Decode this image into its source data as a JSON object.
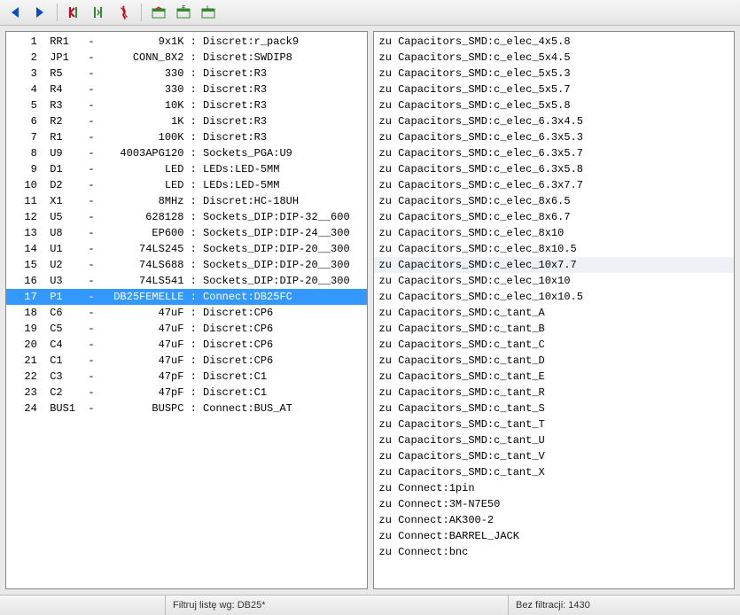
{
  "toolbar": {
    "buttons": [
      {
        "name": "nav-back-icon",
        "title": "Back"
      },
      {
        "name": "nav-forward-icon",
        "title": "Forward"
      },
      {
        "sep": true
      },
      {
        "name": "tool-red-icon",
        "title": "Tool A"
      },
      {
        "name": "tool-green-icon",
        "title": "Tool B"
      },
      {
        "name": "pdf-icon",
        "title": "PDF"
      },
      {
        "sep": true
      },
      {
        "name": "table-a-icon",
        "title": "Table A"
      },
      {
        "name": "table-b-icon",
        "title": "Table B"
      },
      {
        "name": "table-c-icon",
        "title": "Table C"
      }
    ]
  },
  "left_pane": {
    "selected_index": 16,
    "rows": [
      {
        "n": 1,
        "ref": "RR1",
        "dash": "-",
        "val": "9x1K",
        "sepc": ":",
        "fp": "Discret:r_pack9"
      },
      {
        "n": 2,
        "ref": "JP1",
        "dash": "-",
        "val": "CONN_8X2",
        "sepc": ":",
        "fp": "Discret:SWDIP8"
      },
      {
        "n": 3,
        "ref": "R5",
        "dash": "-",
        "val": "330",
        "sepc": ":",
        "fp": "Discret:R3"
      },
      {
        "n": 4,
        "ref": "R4",
        "dash": "-",
        "val": "330",
        "sepc": ":",
        "fp": "Discret:R3"
      },
      {
        "n": 5,
        "ref": "R3",
        "dash": "-",
        "val": "10K",
        "sepc": ":",
        "fp": "Discret:R3"
      },
      {
        "n": 6,
        "ref": "R2",
        "dash": "-",
        "val": "1K",
        "sepc": ":",
        "fp": "Discret:R3"
      },
      {
        "n": 7,
        "ref": "R1",
        "dash": "-",
        "val": "100K",
        "sepc": ":",
        "fp": "Discret:R3"
      },
      {
        "n": 8,
        "ref": "U9",
        "dash": "-",
        "val": "4003APG120",
        "sepc": ":",
        "fp": "Sockets_PGA:U9"
      },
      {
        "n": 9,
        "ref": "D1",
        "dash": "-",
        "val": "LED",
        "sepc": ":",
        "fp": "LEDs:LED-5MM"
      },
      {
        "n": 10,
        "ref": "D2",
        "dash": "-",
        "val": "LED",
        "sepc": ":",
        "fp": "LEDs:LED-5MM"
      },
      {
        "n": 11,
        "ref": "X1",
        "dash": "-",
        "val": "8MHz",
        "sepc": ":",
        "fp": "Discret:HC-18UH"
      },
      {
        "n": 12,
        "ref": "U5",
        "dash": "-",
        "val": "628128",
        "sepc": ":",
        "fp": "Sockets_DIP:DIP-32__600"
      },
      {
        "n": 13,
        "ref": "U8",
        "dash": "-",
        "val": "EP600",
        "sepc": ":",
        "fp": "Sockets_DIP:DIP-24__300"
      },
      {
        "n": 14,
        "ref": "U1",
        "dash": "-",
        "val": "74LS245",
        "sepc": ":",
        "fp": "Sockets_DIP:DIP-20__300"
      },
      {
        "n": 15,
        "ref": "U2",
        "dash": "-",
        "val": "74LS688",
        "sepc": ":",
        "fp": "Sockets_DIP:DIP-20__300"
      },
      {
        "n": 16,
        "ref": "U3",
        "dash": "-",
        "val": "74LS541",
        "sepc": ":",
        "fp": "Sockets_DIP:DIP-20__300"
      },
      {
        "n": 17,
        "ref": "P1",
        "dash": "-",
        "val": "DB25FEMELLE",
        "sepc": ":",
        "fp": "Connect:DB25FC"
      },
      {
        "n": 18,
        "ref": "C6",
        "dash": "-",
        "val": "47uF",
        "sepc": ":",
        "fp": "Discret:CP6"
      },
      {
        "n": 19,
        "ref": "C5",
        "dash": "-",
        "val": "47uF",
        "sepc": ":",
        "fp": "Discret:CP6"
      },
      {
        "n": 20,
        "ref": "C4",
        "dash": "-",
        "val": "47uF",
        "sepc": ":",
        "fp": "Discret:CP6"
      },
      {
        "n": 21,
        "ref": "C1",
        "dash": "-",
        "val": "47uF",
        "sepc": ":",
        "fp": "Discret:CP6"
      },
      {
        "n": 22,
        "ref": "C3",
        "dash": "-",
        "val": "47pF",
        "sepc": ":",
        "fp": "Discret:C1"
      },
      {
        "n": 23,
        "ref": "C2",
        "dash": "-",
        "val": "47pF",
        "sepc": ":",
        "fp": "Discret:C1"
      },
      {
        "n": 24,
        "ref": "BUS1",
        "dash": "-",
        "val": "BUSPC",
        "sepc": ":",
        "fp": "Connect:BUS_AT"
      }
    ]
  },
  "right_pane": {
    "hover_index": 14,
    "prefix": "zu",
    "items": [
      "Capacitors_SMD:c_elec_4x5.8",
      "Capacitors_SMD:c_elec_5x4.5",
      "Capacitors_SMD:c_elec_5x5.3",
      "Capacitors_SMD:c_elec_5x5.7",
      "Capacitors_SMD:c_elec_5x5.8",
      "Capacitors_SMD:c_elec_6.3x4.5",
      "Capacitors_SMD:c_elec_6.3x5.3",
      "Capacitors_SMD:c_elec_6.3x5.7",
      "Capacitors_SMD:c_elec_6.3x5.8",
      "Capacitors_SMD:c_elec_6.3x7.7",
      "Capacitors_SMD:c_elec_8x6.5",
      "Capacitors_SMD:c_elec_8x6.7",
      "Capacitors_SMD:c_elec_8x10",
      "Capacitors_SMD:c_elec_8x10.5",
      "Capacitors_SMD:c_elec_10x7.7",
      "Capacitors_SMD:c_elec_10x10",
      "Capacitors_SMD:c_elec_10x10.5",
      "Capacitors_SMD:c_tant_A",
      "Capacitors_SMD:c_tant_B",
      "Capacitors_SMD:c_tant_C",
      "Capacitors_SMD:c_tant_D",
      "Capacitors_SMD:c_tant_E",
      "Capacitors_SMD:c_tant_R",
      "Capacitors_SMD:c_tant_S",
      "Capacitors_SMD:c_tant_T",
      "Capacitors_SMD:c_tant_U",
      "Capacitors_SMD:c_tant_V",
      "Capacitors_SMD:c_tant_X",
      "Connect:1pin",
      "Connect:3M-N7E50",
      "Connect:AK300-2",
      "Connect:BARREL_JACK",
      "Connect:bnc"
    ]
  },
  "status": {
    "filter_label": "Filtruj listę wg: DB25*",
    "right_label": "Bez filtracji: 1430"
  },
  "colors": {
    "selection": "#3399ff",
    "arrow_blue": "#0a4fbf",
    "pdf_red": "#d0021b",
    "green": "#2e8b2e"
  }
}
